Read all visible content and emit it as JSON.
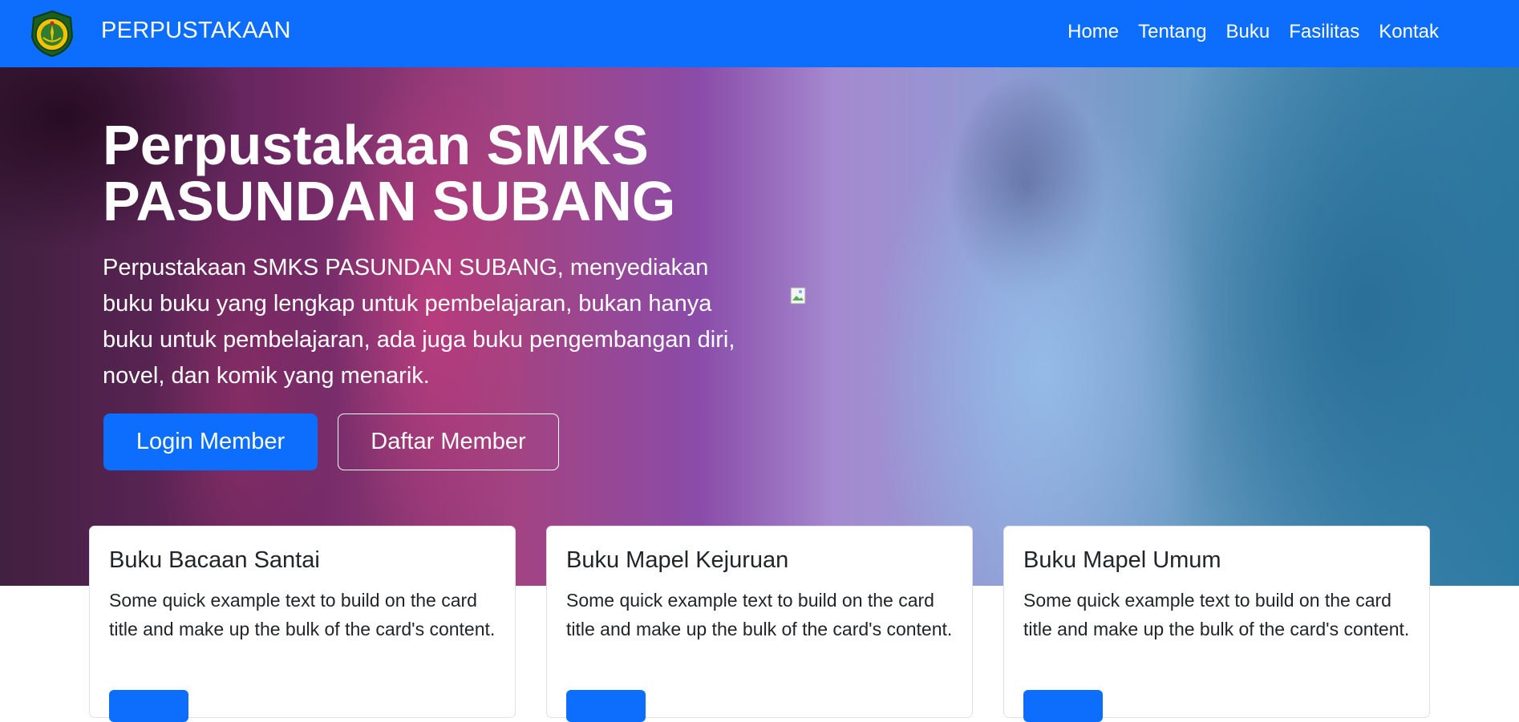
{
  "navbar": {
    "brand": "PERPUSTAKAAN",
    "logo_icon": "school-crest-icon",
    "links": [
      {
        "label": "Home"
      },
      {
        "label": "Tentang"
      },
      {
        "label": "Buku"
      },
      {
        "label": "Fasilitas"
      },
      {
        "label": "Kontak"
      }
    ],
    "background_color": "#0d6efd"
  },
  "hero": {
    "title_line1": "Perpustakaan SMKS",
    "title_line2": "PASUNDAN SUBANG",
    "lead": "Perpustakaan SMKS PASUNDAN SUBANG, menyediakan buku buku yang lengkap untuk pembelajaran, bukan hanya buku untuk pembelajaran, ada juga buku pengembangan diri, novel, dan komik yang menarik.",
    "primary_button": "Login Member",
    "secondary_button": "Daftar Member",
    "broken_image_icon": "broken-image-icon"
  },
  "cards": [
    {
      "title": "Buku Bacaan Santai",
      "text": "Some quick example text to build on the card title and make up the bulk of the card's content."
    },
    {
      "title": "Buku Mapel Kejuruan",
      "text": "Some quick example text to build on the card title and make up the bulk of the card's content."
    },
    {
      "title": "Buku Mapel Umum",
      "text": "Some quick example text to build on the card title and make up the bulk of the card's content."
    }
  ],
  "colors": {
    "primary": "#0d6efd",
    "text": "#212529",
    "card_border": "#dee2e6"
  }
}
